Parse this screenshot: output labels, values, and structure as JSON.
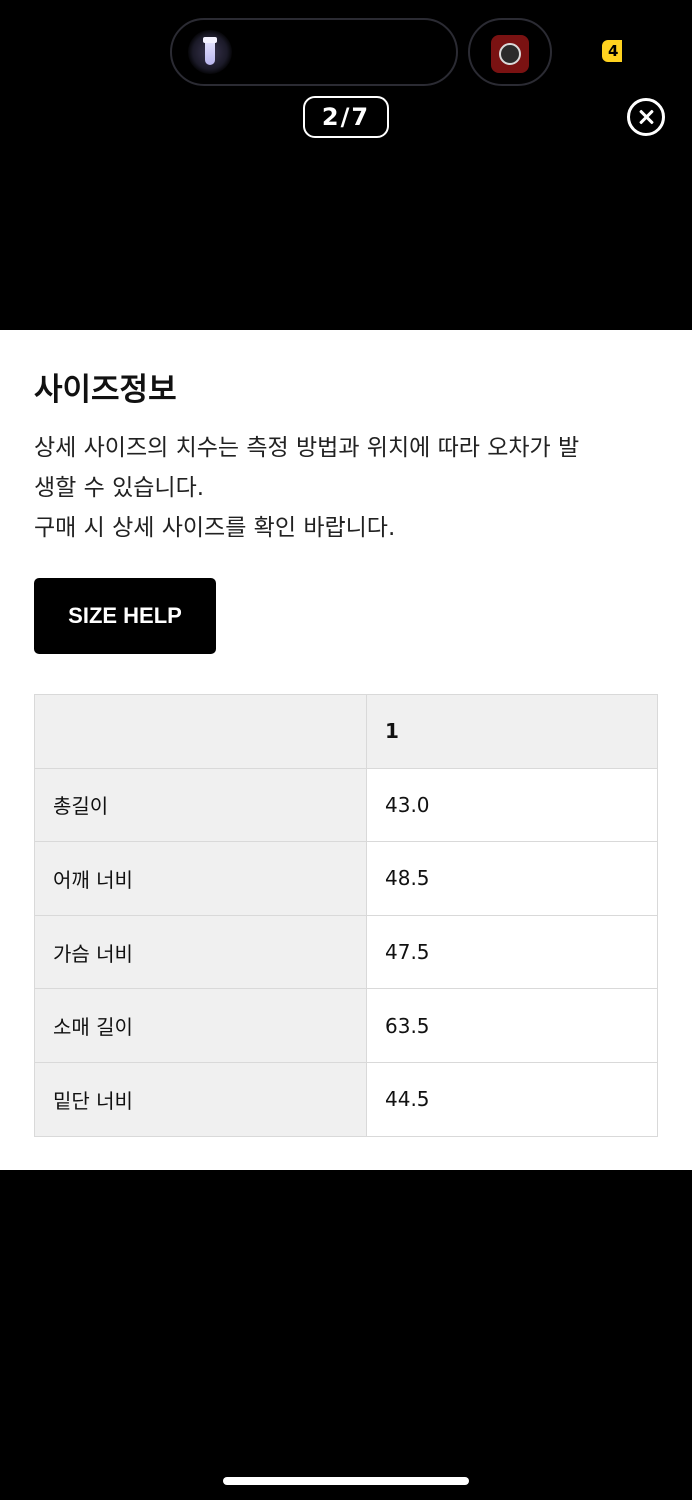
{
  "status_bar": {
    "live_badge_text": "4"
  },
  "viewer": {
    "page_counter": "2/7"
  },
  "size_info": {
    "title": "사이즈정보",
    "description_lines": [
      "상세 사이즈의 치수는 측정 방법과 위치에 따라 오차가 발",
      "생할 수 있습니다.",
      "구매 시 상세 사이즈를 확인 바랍니다."
    ],
    "size_help_label": "SIZE HELP",
    "table": {
      "header": [
        "",
        "1"
      ],
      "rows": [
        {
          "label": "총길이",
          "value": "43.0"
        },
        {
          "label": "어깨 너비",
          "value": "48.5"
        },
        {
          "label": "가슴 너비",
          "value": "47.5"
        },
        {
          "label": "소매 길이",
          "value": "63.5"
        },
        {
          "label": "밑단 너비",
          "value": "44.5"
        }
      ]
    }
  },
  "colors": {
    "background": "#000000",
    "card": "#ffffff",
    "table_header_bg": "#f0f0f0",
    "live_badge": "#ffd21f"
  },
  "icons": [
    "flashlight-icon",
    "app-thumbnail-icon",
    "close-icon"
  ]
}
